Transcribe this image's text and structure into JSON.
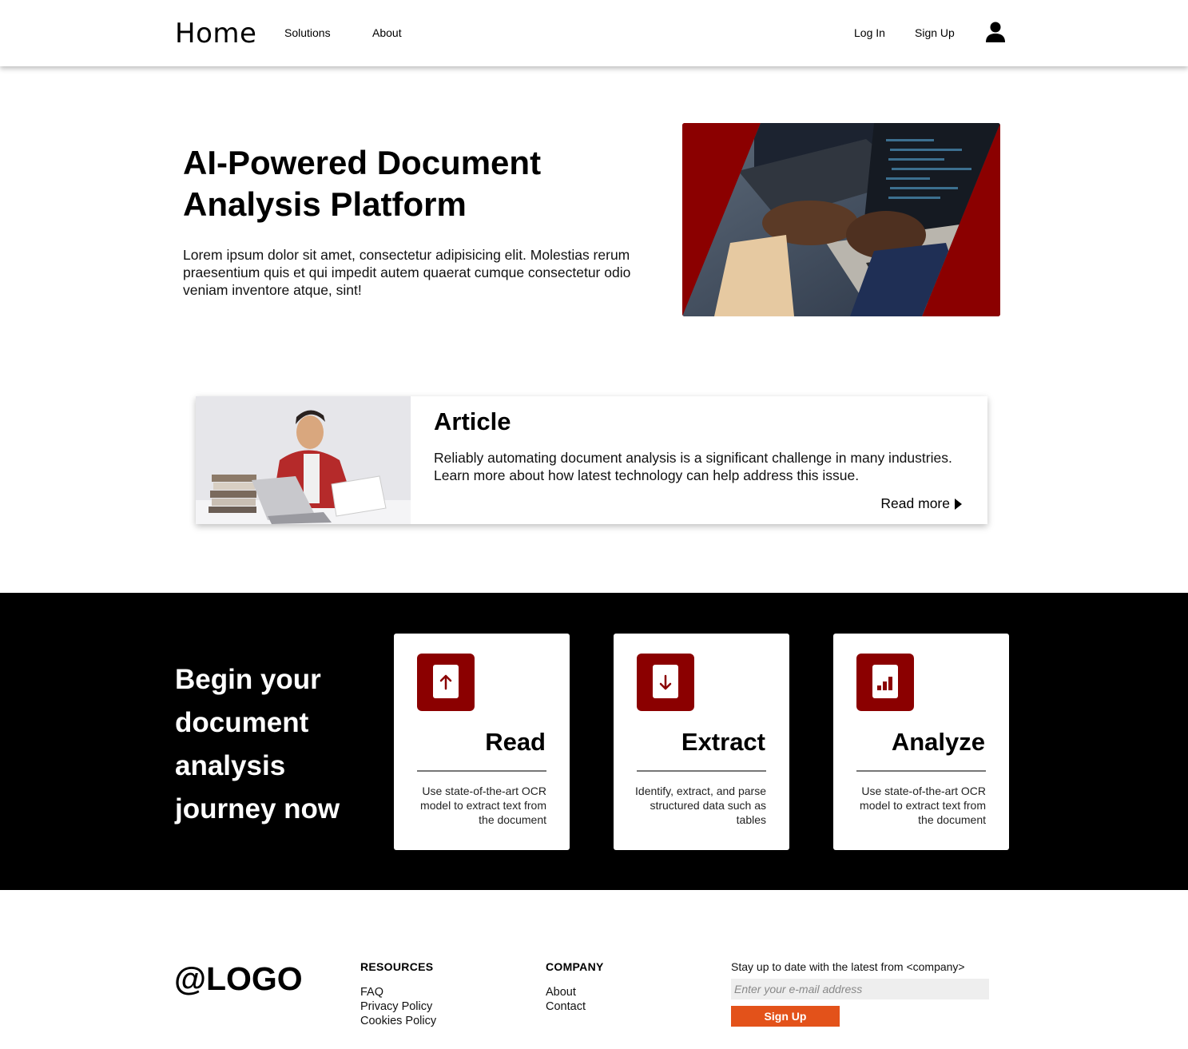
{
  "nav": {
    "home": "Home",
    "solutions": "Solutions",
    "about": "About",
    "login": "Log In",
    "signup": "Sign Up",
    "user_icon": "user-icon"
  },
  "hero": {
    "title": "AI-Powered Document Analysis Platform",
    "text": "Lorem ipsum dolor sit amet, consectetur adipisicing elit. Molestias rerum praesentium quis et qui impedit autem quaerat cumque consectetur odio veniam inventore atque, sint!",
    "accent_color": "#8b0000"
  },
  "article": {
    "title": "Article",
    "text": "Reliably automating document analysis is a significant challenge in many industries. Learn more about how latest technology can help address this issue.",
    "read_more": "Read more"
  },
  "band": {
    "title": "Begin your document analysis journey now",
    "cards": [
      {
        "title": "Read",
        "desc": "Use state-of-the-art OCR model to extract text from the document",
        "icon": "upload-arrow-icon"
      },
      {
        "title": "Extract",
        "desc": "Identify, extract, and parse structured data such as tables",
        "icon": "download-arrow-icon"
      },
      {
        "title": "Analyze",
        "desc": "Use state-of-the-art OCR model to extract text from the document",
        "icon": "bar-chart-icon"
      }
    ]
  },
  "footer": {
    "logo": "@LOGO",
    "resources": {
      "heading": "RESOURCES",
      "items": [
        "FAQ",
        "Privacy Policy",
        "Cookies Policy"
      ]
    },
    "company": {
      "heading": "COMPANY",
      "items": [
        "About",
        "Contact"
      ]
    },
    "newsletter": {
      "text": "Stay up to date with the latest from <company>",
      "placeholder": "Enter your e-mail address",
      "button": "Sign Up",
      "button_color": "#e3521a"
    }
  }
}
